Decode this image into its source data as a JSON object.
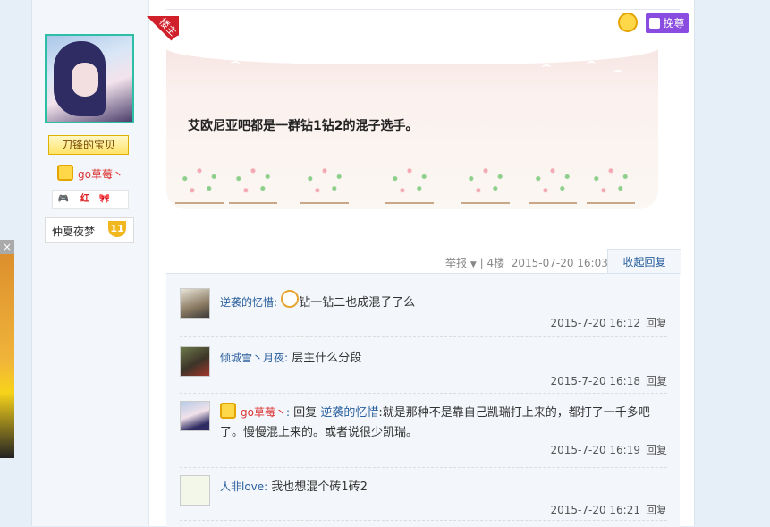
{
  "ad": {
    "close_glyph": "×"
  },
  "author": {
    "floor_badge": "楼主",
    "title_badge": "刀锋的宝贝",
    "name": "go草莓丶",
    "icons": {
      "one": "🎮",
      "two": "红",
      "three": "🎀"
    },
    "level_name": "仲夏夜梦",
    "level": "11"
  },
  "post": {
    "text": "艾欧尼亚吧都是一群钻1钻2的混子选手。",
    "save_button": "挽尊"
  },
  "meta": {
    "report": "举报",
    "floor": "4楼",
    "time": "2015-07-20 16:03",
    "collapse": "收起回复"
  },
  "replies": [
    {
      "user": "逆袭的忆惜",
      "text": "钻一钻二也成混子了么",
      "time": "2015-7-20 16:12",
      "reply": "回复"
    },
    {
      "user": "倾城雪丶月夜",
      "text": "层主什么分段",
      "time": "2015-7-20 16:18",
      "reply": "回复"
    },
    {
      "user": "go草莓丶",
      "prefix": "回复",
      "target": "逆袭的忆惜",
      "text": ":就是那种不是靠自己凯瑞打上来的，都打了一千多吧了。慢慢混上来的。或者说很少凯瑞。",
      "time": "2015-7-20 16:19",
      "reply": "回复"
    },
    {
      "user": "人非love",
      "text": "我也想混个砖1砖2",
      "time": "2015-7-20 16:21",
      "reply": "回复"
    }
  ],
  "colors": {
    "accent": "#2a5f9e",
    "vip_red": "#dd3333",
    "floor_badge": "#d0202a",
    "save_button": "#8a4be0"
  },
  "icon_names": [
    "close-icon",
    "crown-icon",
    "thumb-icon",
    "vip-crown-icon",
    "caret-down-icon",
    "emoji-icon"
  ]
}
